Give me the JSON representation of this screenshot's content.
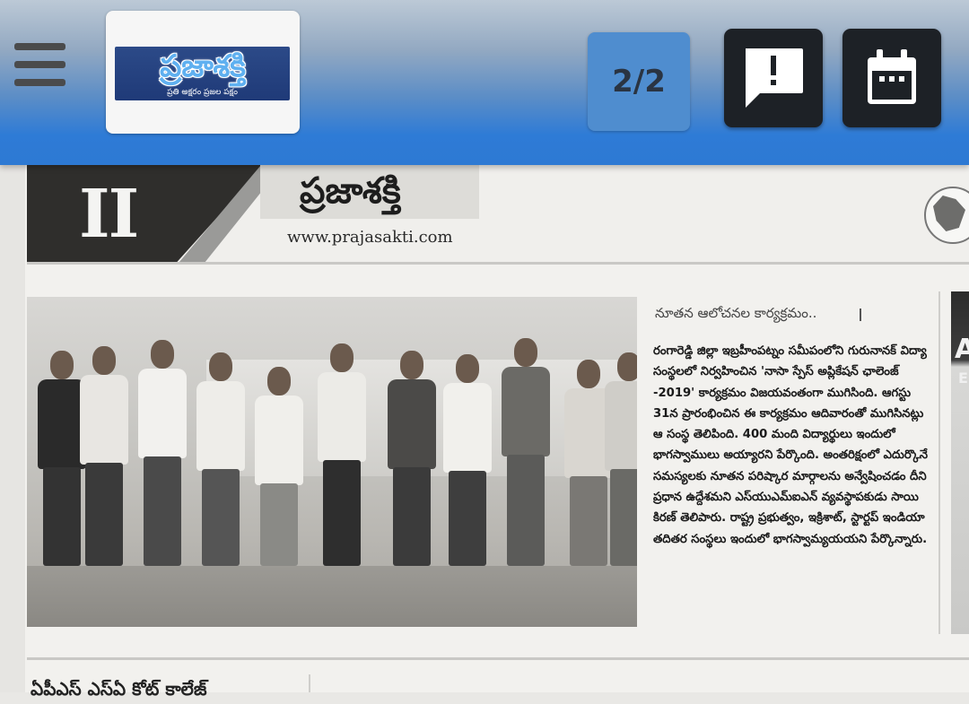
{
  "app_bar": {
    "menu_icon": "hamburger-menu-icon",
    "logo": {
      "text": "ప్రజాశక్తి",
      "tagline": "ప్రతి అక్షరం ప్రజల పక్షం"
    },
    "page_indicator": "2/2",
    "feedback_icon": "feedback-exclamation-icon",
    "calendar_icon": "calendar-icon"
  },
  "newspaper": {
    "page_number": "II",
    "brand_name": "ప్రజాశక్తి",
    "url": "www.prajasakti.com",
    "article": {
      "kicker": "నూతన ఆలోచనల కార్యక్రమం..",
      "body": "రంగారెడ్డి జిల్లా ఇబ్రహీంపట్నం సమీపంలోని గురునానక్ విద్యా సంస్థలలో నిర్వహించిన 'నాసా స్పేస్ అప్లికేషన్ ఛాలెంజ్ -2019' కార్యక్రమం విజయవంతంగా ముగిసింది. ఆగస్టు 31న ప్రారంభించిన ఈ కార్యక్రమం ఆదివారంతో ముగిసినట్లు ఆ సంస్థ తెలిపింది. 400 మంది విద్యార్థులు ఇందులో భాగస్వాములు అయ్యారని పేర్కొంది. అంతరిక్షంలో ఎదుర్కొనే సమస్యలకు నూతన పరిష్కార మార్గాలను అన్వేషించడం దీని ప్రధాన ఉద్దేశమని ఎస్‌యుఎమ్‌ఐఎన్ వ్యవస్థాపకుడు సాయి కిరణ్ తెలిపారు. రాష్ట్ర ప్రభుత్వం, ఇక్రిశాట్, స్టార్టప్ ఇండియా తదితర సంస్థలు ఇందులో భాగస్వామ్యయయని పేర్కొన్నారు."
    },
    "next_ad_letters": [
      "A",
      "E"
    ],
    "bottom_headline": "ఏపీఎస్ ఎస్ఏ కోట్ కాలేజ్"
  },
  "colors": {
    "top_bar_blue": "#2e7bd6",
    "page_indicator_bg": "#4f8dcf",
    "dark_button": "#1d2126",
    "masthead_dark": "#2f2e2c"
  }
}
